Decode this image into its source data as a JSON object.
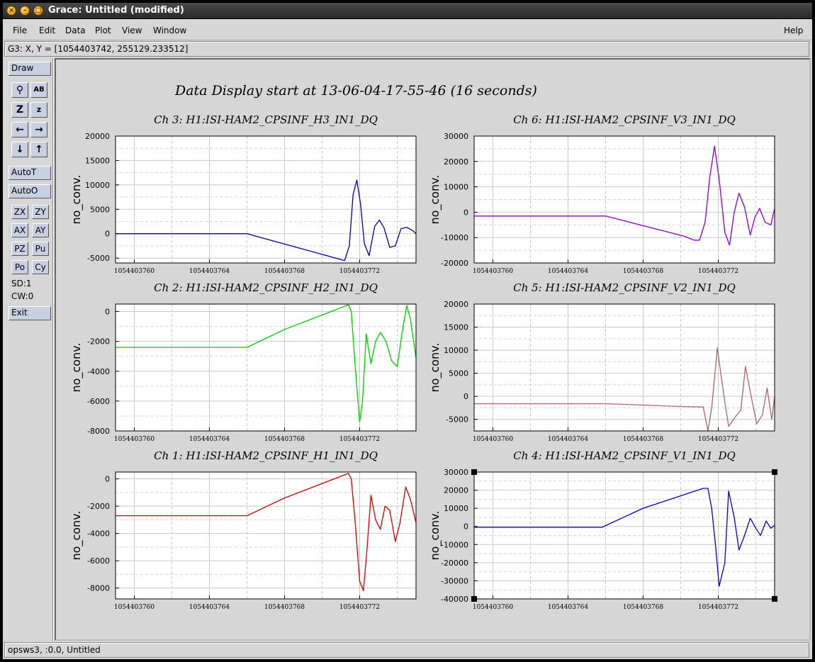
{
  "window": {
    "title": "Grace: Untitled (modified)"
  },
  "menubar": {
    "items": [
      "File",
      "Edit",
      "Data",
      "Plot",
      "View",
      "Window"
    ],
    "help": "Help"
  },
  "locator": "G3: X, Y = [1054403742, 255129.233512]",
  "toolbar": {
    "draw": "Draw",
    "autot": "AutoT",
    "autoo": "AutoO",
    "small_buttons": [
      "ZX",
      "ZY",
      "AX",
      "AY",
      "PZ",
      "Pu",
      "Po",
      "Cy"
    ],
    "sd": "SD:1",
    "cw": "CW:0",
    "exit": "Exit",
    "icons": [
      "zoom-icon",
      "text-icon",
      "zoom-in-icon",
      "zoom-out-icon",
      "left-arrow-icon",
      "right-arrow-icon",
      "down-arrow-icon",
      "up-arrow-icon"
    ]
  },
  "statusbar": "opsws3, :0.0, Untitled",
  "main_title": "Data Display start at 13-06-04-17-55-46 (16 seconds)",
  "chart_data": [
    {
      "type": "line",
      "title": "Ch 3: H1:ISI-HAM2_CPSINF_H3_IN1_DQ",
      "ylabel": "no_conv.",
      "color": "#0000aa",
      "xlim": [
        1054403759,
        1054403775
      ],
      "ylim": [
        -6000,
        20000
      ],
      "xticks": [
        "1054403760",
        "1054403764",
        "1054403768",
        "1054403772"
      ],
      "yticks": [
        "20000",
        "15000",
        "10000",
        "5000",
        "0",
        "-5000"
      ],
      "ytick_values": [
        20000,
        15000,
        10000,
        5000,
        0,
        -5000
      ],
      "x": [
        1054403759,
        1054403766,
        1054403771.2,
        1054403771.45,
        1054403771.65,
        1054403771.85,
        1054403772.05,
        1054403772.25,
        1054403772.5,
        1054403772.8,
        1054403773.05,
        1054403773.3,
        1054403773.6,
        1054403773.9,
        1054403774.2,
        1054403774.5,
        1054403774.8,
        1054403775
      ],
      "y": [
        0,
        0,
        -5500,
        -2500,
        8000,
        11000,
        6000,
        -2000,
        -4500,
        1500,
        2800,
        1200,
        -2800,
        -2500,
        1000,
        1300,
        700,
        0
      ]
    },
    {
      "type": "line",
      "title": "Ch 6: H1:ISI-HAM2_CPSINF_V3_IN1_DQ",
      "ylabel": "no_conv.",
      "color": "#8800cc",
      "xlim": [
        1054403759,
        1054403775
      ],
      "ylim": [
        -20000,
        30000
      ],
      "xticks": [
        "1054403760",
        "1054403764",
        "1054403768",
        "1054403772"
      ],
      "yticks": [
        "30000",
        "20000",
        "10000",
        "0",
        "-10000",
        "-20000"
      ],
      "ytick_values": [
        30000,
        20000,
        10000,
        0,
        -10000,
        -20000
      ],
      "x": [
        1054403759,
        1054403766,
        1054403770.2,
        1054403770.7,
        1054403771.0,
        1054403771.3,
        1054403771.55,
        1054403771.8,
        1054403772.05,
        1054403772.35,
        1054403772.6,
        1054403772.85,
        1054403773.1,
        1054403773.4,
        1054403773.7,
        1054403773.95,
        1054403774.2,
        1054403774.5,
        1054403774.8,
        1054403775
      ],
      "y": [
        -1500,
        -1500,
        -9500,
        -11000,
        -11000,
        -4000,
        14000,
        26000,
        13000,
        -8000,
        -13000,
        0,
        7500,
        2000,
        -9000,
        -2000,
        1500,
        -4000,
        -5000,
        1500
      ]
    },
    {
      "type": "line",
      "title": "Ch 2: H1:ISI-HAM2_CPSINF_H2_IN1_DQ",
      "ylabel": "no_conv.",
      "color": "#00cc00",
      "xlim": [
        1054403759,
        1054403775
      ],
      "ylim": [
        -8000,
        500
      ],
      "xticks": [
        "1054403760",
        "1054403764",
        "1054403768",
        "1054403772"
      ],
      "yticks": [
        "0",
        "-2000",
        "-4000",
        "-6000",
        "-8000"
      ],
      "ytick_values": [
        0,
        -2000,
        -4000,
        -6000,
        -8000
      ],
      "x": [
        1054403759,
        1054403766,
        1054403768,
        1054403771.4,
        1054403771.55,
        1054403771.75,
        1054403772.0,
        1054403772.15,
        1054403772.35,
        1054403772.6,
        1054403772.85,
        1054403773.1,
        1054403773.4,
        1054403773.7,
        1054403774.0,
        1054403774.25,
        1054403774.5,
        1054403774.7,
        1054403775
      ],
      "y": [
        -2400,
        -2400,
        -1200,
        450,
        0,
        -3500,
        -7400,
        -6000,
        -1500,
        -3500,
        -2000,
        -1400,
        -2000,
        -3300,
        -3700,
        -1500,
        400,
        -500,
        -3100
      ]
    },
    {
      "type": "line",
      "title": "Ch 5: H1:ISI-HAM2_CPSINF_V2_IN1_DQ",
      "ylabel": "no_conv.",
      "color": "#aa6666",
      "xlim": [
        1054403759,
        1054403775
      ],
      "ylim": [
        -7500,
        20000
      ],
      "xticks": [
        "1054403760",
        "1054403764",
        "1054403768",
        "1054403772"
      ],
      "yticks": [
        "20000",
        "15000",
        "10000",
        "5000",
        "0",
        "-5000"
      ],
      "ytick_values": [
        20000,
        15000,
        10000,
        5000,
        0,
        -5000
      ],
      "x": [
        1054403759,
        1054403766,
        1054403770,
        1054403771.2,
        1054403771.45,
        1054403771.65,
        1054403771.95,
        1054403772.25,
        1054403772.55,
        1054403772.9,
        1054403773.2,
        1054403773.45,
        1054403773.75,
        1054403774.05,
        1054403774.35,
        1054403774.6,
        1054403774.85,
        1054403775
      ],
      "y": [
        -1600,
        -1600,
        -2200,
        -2300,
        -7500,
        -2500,
        10500,
        1500,
        -6500,
        -4500,
        -3000,
        6500,
        0,
        -6000,
        -4000,
        1800,
        -5000,
        0
      ]
    },
    {
      "type": "line",
      "title": "Ch 1: H1:ISI-HAM2_CPSINF_H1_IN1_DQ",
      "ylabel": "no_conv.",
      "color": "#cc0000",
      "xlim": [
        1054403759,
        1054403775
      ],
      "ylim": [
        -8800,
        500
      ],
      "xticks": [
        "1054403760",
        "1054403764",
        "1054403768",
        "1054403772"
      ],
      "yticks": [
        "0",
        "-2000",
        "-4000",
        "-6000",
        "-8000"
      ],
      "ytick_values": [
        0,
        -2000,
        -4000,
        -6000,
        -8000
      ],
      "x": [
        1054403759,
        1054403766,
        1054403768,
        1054403771.4,
        1054403771.55,
        1054403771.75,
        1054403772.0,
        1054403772.2,
        1054403772.4,
        1054403772.6,
        1054403772.85,
        1054403773.1,
        1054403773.35,
        1054403773.6,
        1054403773.9,
        1054403774.15,
        1054403774.45,
        1054403774.7,
        1054403775
      ],
      "y": [
        -2700,
        -2700,
        -1400,
        400,
        0,
        -3000,
        -7500,
        -8200,
        -5000,
        -1200,
        -3000,
        -3700,
        -2000,
        -2300,
        -4600,
        -3200,
        -600,
        -1500,
        -3200
      ]
    },
    {
      "type": "line",
      "title": "Ch 4: H1:ISI-HAM2_CPSINF_V1_IN1_DQ",
      "ylabel": "no_conv.",
      "color": "#0000cc",
      "xlim": [
        1054403759,
        1054403775
      ],
      "ylim": [
        -40000,
        30000
      ],
      "xticks": [
        "1054403760",
        "1054403764",
        "1054403768",
        "1054403772"
      ],
      "yticks": [
        "30000",
        "20000",
        "10000",
        "0",
        "-10000",
        "-20000",
        "-30000",
        "-40000"
      ],
      "ytick_values": [
        30000,
        20000,
        10000,
        0,
        -10000,
        -20000,
        -30000,
        -40000
      ],
      "x": [
        1054403759,
        1054403765.8,
        1054403768,
        1054403771.2,
        1054403771.45,
        1054403771.65,
        1054403771.85,
        1054403772.05,
        1054403772.35,
        1054403772.55,
        1054403772.85,
        1054403773.1,
        1054403773.4,
        1054403773.7,
        1054403774.0,
        1054403774.25,
        1054403774.55,
        1054403774.8,
        1054403775
      ],
      "y": [
        -500,
        -500,
        10000,
        21000,
        21000,
        10000,
        -10000,
        -33000,
        -20000,
        19500,
        5000,
        -13000,
        -5000,
        4500,
        -1000,
        -5000,
        3000,
        -1000,
        500
      ]
    }
  ]
}
